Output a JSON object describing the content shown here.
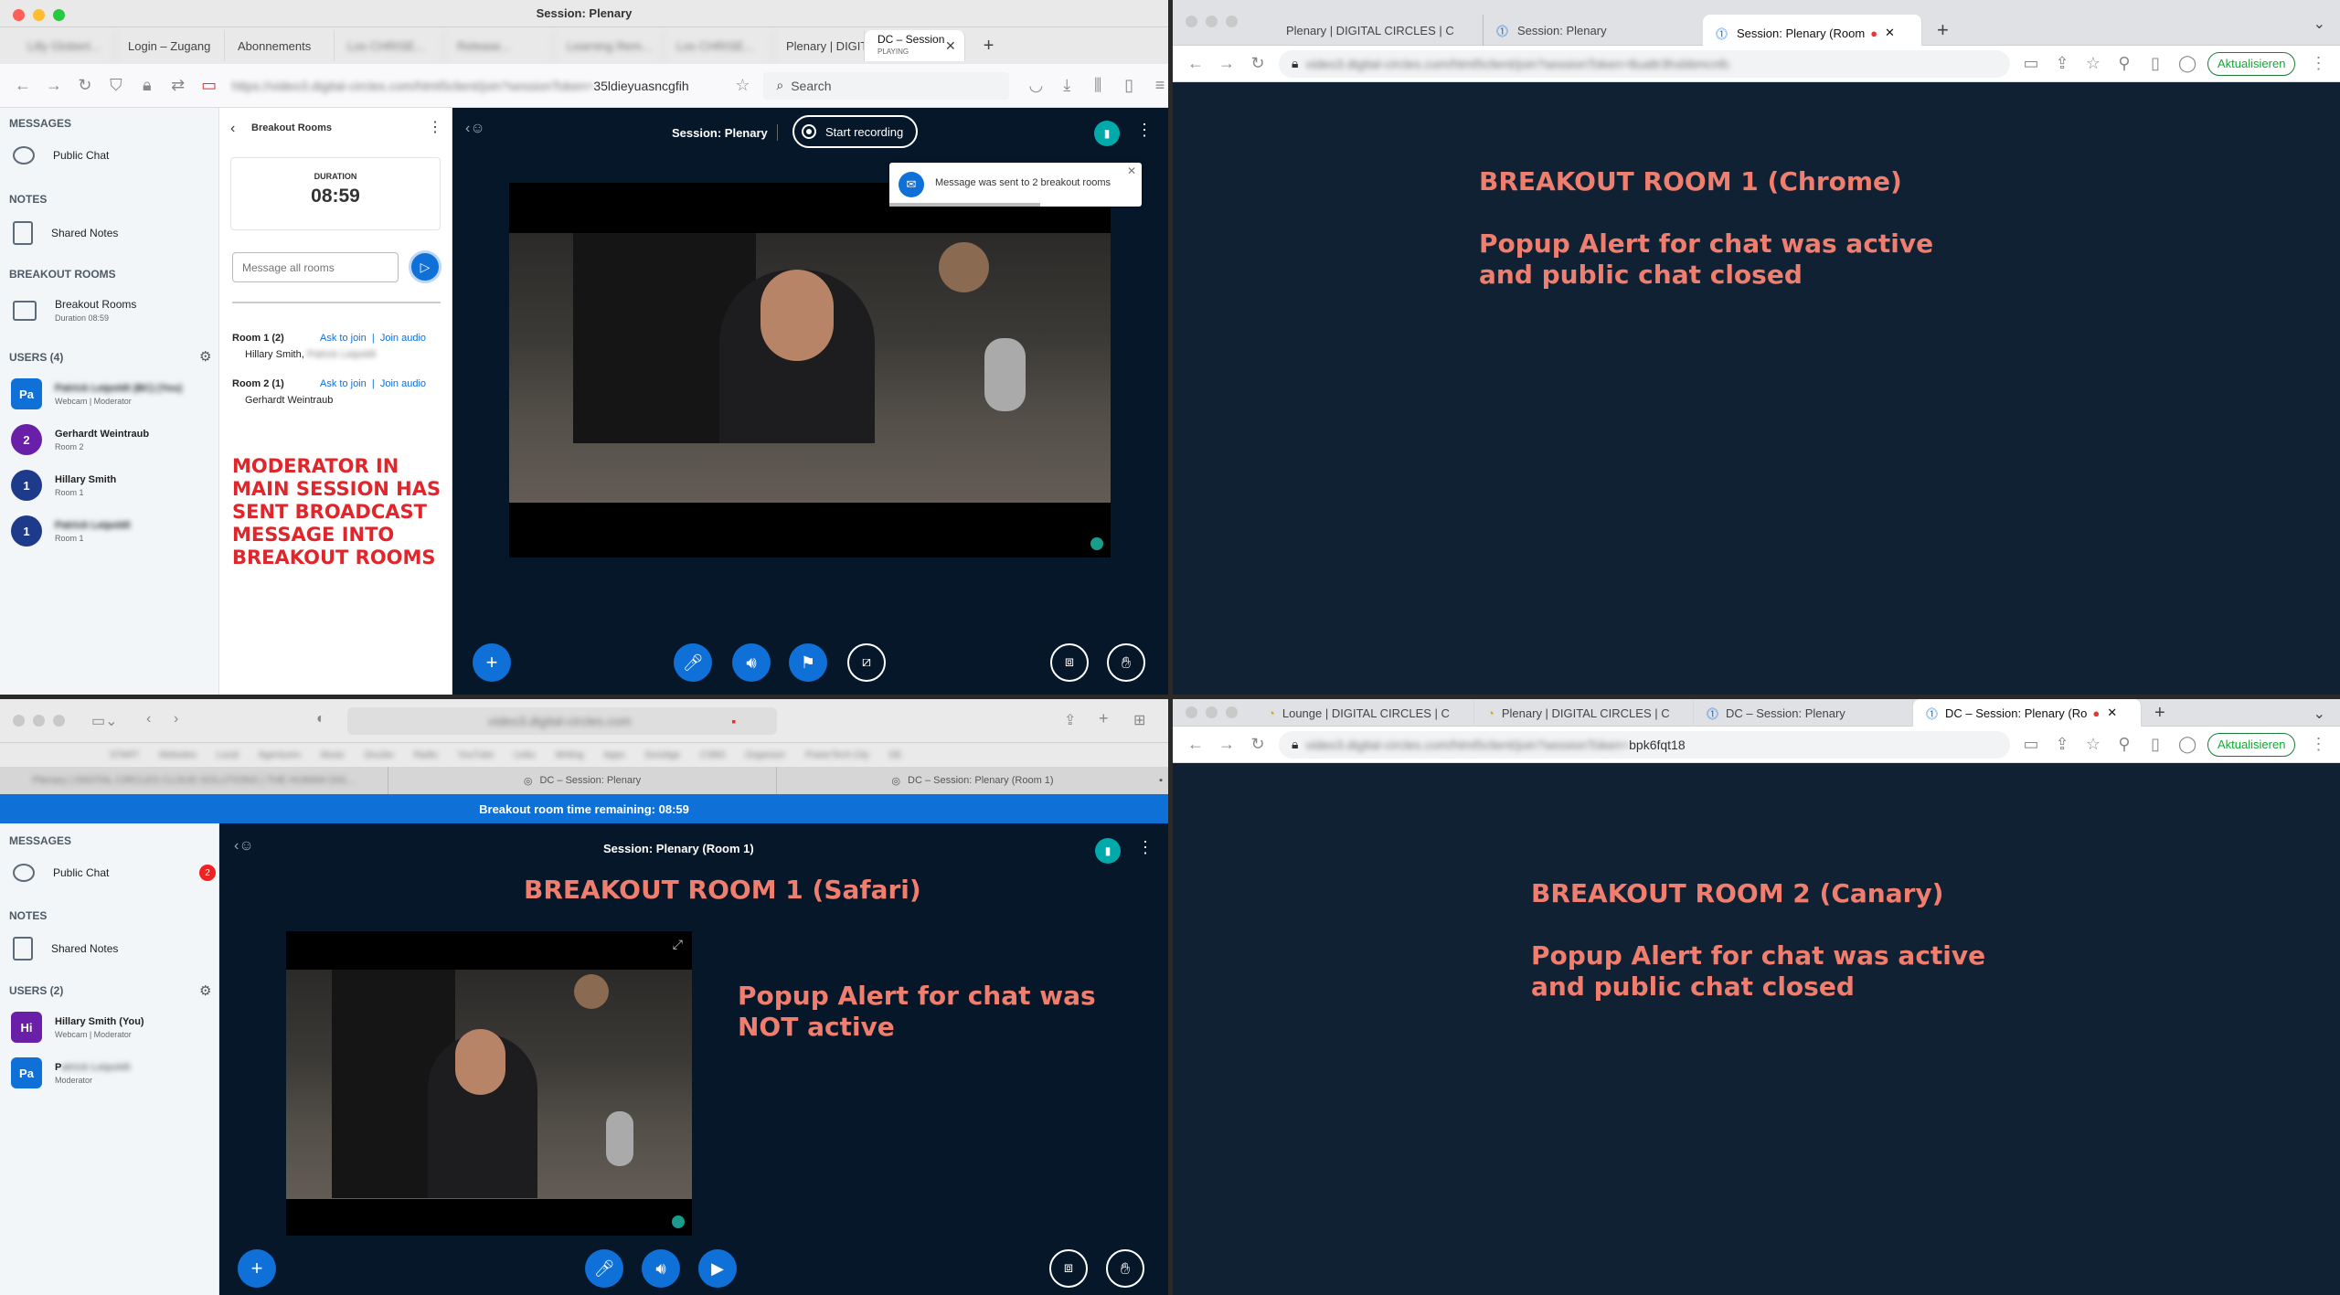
{
  "top_left": {
    "window_title": "Session: Plenary",
    "tabs": [
      "Lilly Globert...",
      "Login – Zugang",
      "Abonnements",
      "Los CHRISE...",
      "Release...",
      "Learning Rem...",
      "Los CHRISE...",
      "Plenary | DIGITA",
      "DC – Session..."
    ],
    "active_tab": "DC – Session",
    "active_tab_sub": "PLAYING",
    "url_blurred": "https://video3.digital-circles.com/html5client/join?sessionToken=",
    "url_tail": "35ldieyuasncgfih",
    "search_placeholder": "Search",
    "sidebar": {
      "messages_header": "MESSAGES",
      "public_chat": "Public Chat",
      "notes_header": "NOTES",
      "shared_notes": "Shared Notes",
      "breakout_header": "BREAKOUT ROOMS",
      "breakout_item": "Breakout Rooms",
      "breakout_duration": "Duration 08:59",
      "users_header": "USERS (4)",
      "users": [
        {
          "initials": "Pa",
          "name": "Patrick Leipoldt (BC) (You)",
          "sub": "Webcam | Moderator",
          "color": "#0f70d7",
          "blur": true
        },
        {
          "initials": "2",
          "name": "Gerhardt Weintraub",
          "sub": "Room 2",
          "color": "#6a1fa8",
          "blur": false
        },
        {
          "initials": "1",
          "name": "Hillary Smith",
          "sub": "Room 1",
          "color": "#1e3a8a",
          "blur": false
        },
        {
          "initials": "1",
          "name": "Patrick Leipoldt",
          "sub": "Room 1",
          "color": "#1e3a8a",
          "blur": true
        }
      ]
    },
    "breakout_panel": {
      "title": "Breakout Rooms",
      "duration_label": "DURATION",
      "duration": "08:59",
      "message_placeholder": "Message all rooms",
      "rooms": [
        {
          "name": "Room 1 (2)",
          "ask": "Ask to join",
          "join": "Join audio",
          "members": "Hillary Smith,",
          "members_blur": "Patrick Leipoldt"
        },
        {
          "name": "Room 2 (1)",
          "ask": "Ask to join",
          "join": "Join audio",
          "members": "Gerhardt Weintraub",
          "members_blur": ""
        }
      ],
      "annotation": "MODERATOR IN MAIN SESSION HAS SENT BROADCAST MESSAGE INTO BREAKOUT ROOMS"
    },
    "main": {
      "session_title": "Session: Plenary",
      "record_label": "Start recording",
      "toast": "Message was sent to 2 breakout rooms"
    }
  },
  "top_right": {
    "tabs": [
      "Plenary | DIGITAL CIRCLES | C",
      "Session: Plenary",
      "Session: Plenary (Room"
    ],
    "url_blurred": "video3.digital-circles.com/html5client/join?sessionToken=8ualtr3hxbbmcnfc",
    "update_label": "Aktualisieren",
    "heading": "BREAKOUT ROOM 1 (Chrome)",
    "note": "Popup Alert for chat was active and public chat closed"
  },
  "bottom_left": {
    "tabs": [
      "Plenary | DIGITAL CIRCLES CLOUD SOLUTIONS | THE HUMAN DIG...",
      "DC – Session: Plenary",
      "DC – Session: Plenary (Room 1)"
    ],
    "bookmarks": [
      "START",
      "Websites",
      "Local",
      "Agenturen",
      "Music",
      "Drucke",
      "Radio",
      "YouTube",
      "Links",
      "Writing",
      "Apps",
      "Sonstige",
      "CSBS",
      "Organizer",
      "PowerTech City",
      "DE"
    ],
    "banner": "Breakout room time remaining: 08:59",
    "sidebar": {
      "messages_header": "MESSAGES",
      "public_chat": "Public Chat",
      "chat_badge": "2",
      "notes_header": "NOTES",
      "shared_notes": "Shared Notes",
      "users_header": "USERS (2)",
      "users": [
        {
          "initials": "Hi",
          "name": "Hillary Smith (You)",
          "sub": "Webcam | Moderator",
          "color": "#6a1fa8"
        },
        {
          "initials": "Pa",
          "name": "P",
          "name_blur": "atrick Leipoldt",
          "sub": "Moderator",
          "color": "#0f70d7"
        }
      ]
    },
    "main": {
      "session_title": "Session: Plenary (Room 1)",
      "heading": "BREAKOUT ROOM 1 (Safari)",
      "note": "Popup Alert for chat was NOT active"
    }
  },
  "bottom_right": {
    "tabs": [
      "Lounge | DIGITAL CIRCLES | C",
      "Plenary | DIGITAL CIRCLES | C",
      "DC – Session: Plenary",
      "DC – Session: Plenary (Ro"
    ],
    "url_blurred": "video3.digital-circles.com/html5client/join?sessionToken=",
    "url_tail": "bpk6fqt18",
    "update_label": "Aktualisieren",
    "heading": "BREAKOUT ROOM 2 (Canary)",
    "note": "Popup Alert for chat was active and public chat closed"
  },
  "colors": {
    "accent": "#0f70d7",
    "dark_bg": "#06172a",
    "note": "#f07e6e",
    "red_note": "#e0262b",
    "banner": "#0f70d7"
  }
}
